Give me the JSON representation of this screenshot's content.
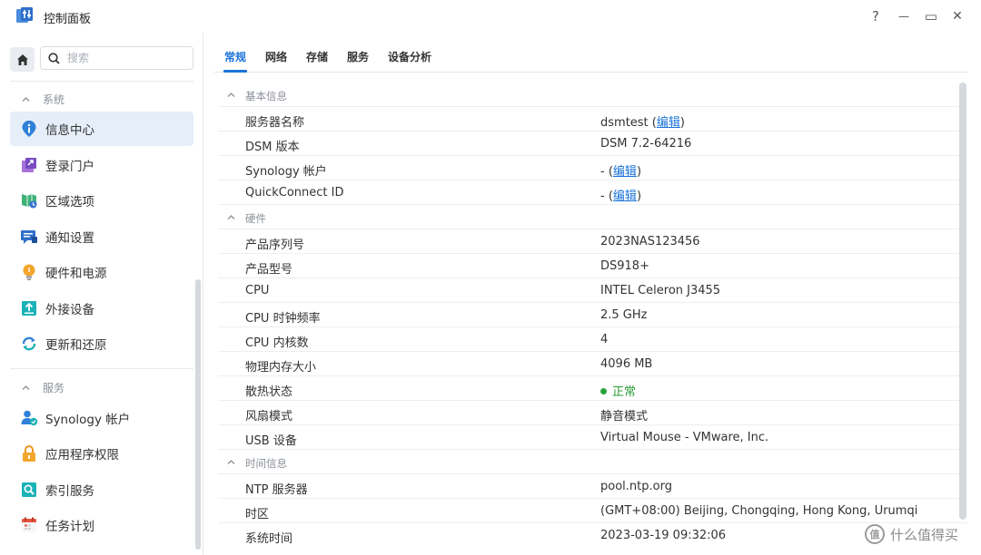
{
  "window": {
    "title": "控制面板",
    "help_glyph": "?",
    "minimize_glyph": "—",
    "maximize_glyph": "▭",
    "close_glyph": "✕"
  },
  "sidebar": {
    "search_placeholder": "搜索",
    "sections": [
      {
        "label": "系统",
        "items": [
          {
            "label": "信息中心",
            "icon": "info-icon",
            "active": true
          },
          {
            "label": "登录门户",
            "icon": "login-portal-icon"
          },
          {
            "label": "区域选项",
            "icon": "regional-options-icon"
          },
          {
            "label": "通知设置",
            "icon": "notification-icon"
          },
          {
            "label": "硬件和电源",
            "icon": "hardware-power-icon"
          },
          {
            "label": "外接设备",
            "icon": "external-devices-icon"
          },
          {
            "label": "更新和还原",
            "icon": "update-restore-icon"
          }
        ]
      },
      {
        "label": "服务",
        "items": [
          {
            "label": "Synology 帐户",
            "icon": "synology-account-icon"
          },
          {
            "label": "应用程序权限",
            "icon": "app-permission-icon"
          },
          {
            "label": "索引服务",
            "icon": "indexing-service-icon"
          },
          {
            "label": "任务计划",
            "icon": "task-scheduler-icon"
          }
        ]
      }
    ]
  },
  "tabs": [
    {
      "label": "常规",
      "active": true
    },
    {
      "label": "网络"
    },
    {
      "label": "存储"
    },
    {
      "label": "服务"
    },
    {
      "label": "设备分析"
    }
  ],
  "info": {
    "basic": {
      "title": "基本信息",
      "server_name_label": "服务器名称",
      "server_name_value": "dsmtest",
      "dsm_version_label": "DSM 版本",
      "dsm_version_value": "DSM 7.2-64216",
      "synology_account_label": "Synology 帐户",
      "synology_account_value": "-",
      "quickconnect_label": "QuickConnect ID",
      "quickconnect_value": "-",
      "edit_link": "编辑"
    },
    "hardware": {
      "title": "硬件",
      "serial_label": "产品序列号",
      "serial_value": "2023NAS123456",
      "model_label": "产品型号",
      "model_value": "DS918+",
      "cpu_label": "CPU",
      "cpu_value": "INTEL Celeron J3455",
      "cpu_clock_label": "CPU 时钟频率",
      "cpu_clock_value": "2.5 GHz",
      "cpu_cores_label": "CPU 内核数",
      "cpu_cores_value": "4",
      "memory_label": "物理内存大小",
      "memory_value": "4096 MB",
      "thermal_label": "散热状态",
      "thermal_value": "正常",
      "thermal_color": "#2aa13b",
      "fan_label": "风扇模式",
      "fan_value": "静音模式",
      "usb_label": "USB 设备",
      "usb_value": "Virtual Mouse - VMware, Inc."
    },
    "time": {
      "title": "时间信息",
      "ntp_label": "NTP 服务器",
      "ntp_value": "pool.ntp.org",
      "timezone_label": "时区",
      "timezone_value": "(GMT+08:00) Beijing, Chongqing, Hong Kong, Urumqi",
      "system_time_label": "系统时间",
      "system_time_value": "2023-03-19 09:32:06"
    }
  },
  "watermark": {
    "badge": "值",
    "text": "什么值得买"
  },
  "colors": {
    "accent": "#1a73d9",
    "active_item_bg": "#e5eef9",
    "status_ok": "#2aa13b"
  }
}
